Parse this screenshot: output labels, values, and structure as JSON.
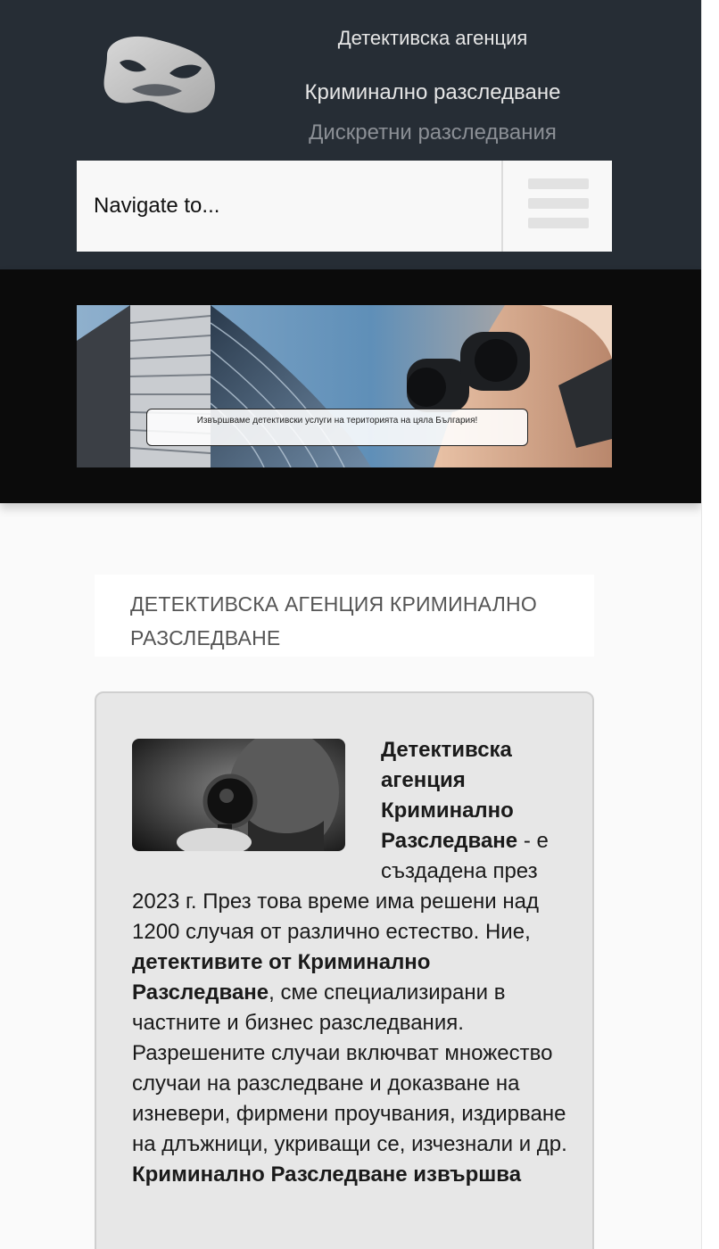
{
  "header": {
    "title": "Детективска агенция",
    "subtitle": "Криминално разследване",
    "tagline": "Дискретни разследвания",
    "nav_placeholder": "Navigate to...",
    "logo_icon": "mask-icon",
    "menu_icon": "hamburger-icon"
  },
  "banner": {
    "caption": "Извършваме детективски услуги на територията на цяла България!"
  },
  "main": {
    "heading_line1": "ДЕТЕКТИВСКА АГЕНЦИЯ КРИМИНАЛНО",
    "heading_line2": "РАЗСЛЕДВАНЕ",
    "intro": {
      "bold_name": "Детективска агенция Криминално Разследване",
      "text1": " - е създадена през 2023 г. През това време има решени над 1200 случая от различно естество. Ние, ",
      "bold_detectives": "детективите от Криминално Разследване",
      "text2": ", сме специализирани в частните и бизнес разследвания. Разрешените случаи включват множество случаи на разследване и доказване на изневери, фирмени проучвания, издирване на длъжници, укриващи се, изчезнали и др. ",
      "bold_tail": "Криминално Разследване извършва"
    }
  },
  "colors": {
    "header_bg": "#262d35",
    "banner_bg": "#0b0b0b",
    "card_bg": "#e7e7e7",
    "tagline": "#8b8f95"
  }
}
